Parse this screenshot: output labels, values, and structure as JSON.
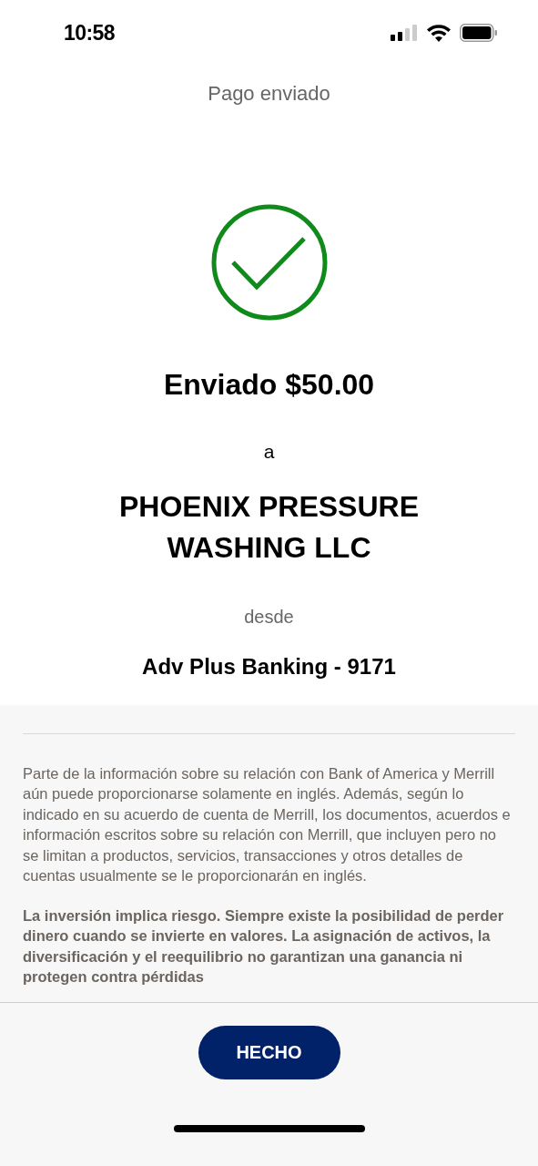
{
  "status_bar": {
    "time": "10:58"
  },
  "header": {
    "title": "Pago enviado"
  },
  "confirmation": {
    "amount_line": "Enviado $50.00",
    "to_label": "a",
    "recipient": "PHOENIX PRESSURE WASHING LLC",
    "from_label": "desde",
    "account": "Adv Plus Banking - 9171"
  },
  "disclosures": [
    {
      "kind": "normal",
      "text": "Parte de la información sobre su relación con Bank of America y Merrill aún puede proporcionarse solamente en inglés. Además, según lo indicado en su acuerdo de cuenta de Merrill, los documentos, acuerdos e información escritos sobre su relación con Merrill, que incluyen pero no se limitan a productos, servicios, transacciones y otros detalles de cuentas usualmente se le proporcionarán en inglés."
    },
    {
      "kind": "bold",
      "text": "La inversión implica riesgo. Siempre existe la posibilidad de perder dinero cuando se invierte en valores. La asignación de activos, la diversificación y el reequilibrio no garantizan una ganancia ni protegen contra pérdidas"
    }
  ],
  "done_button": "HECHO"
}
